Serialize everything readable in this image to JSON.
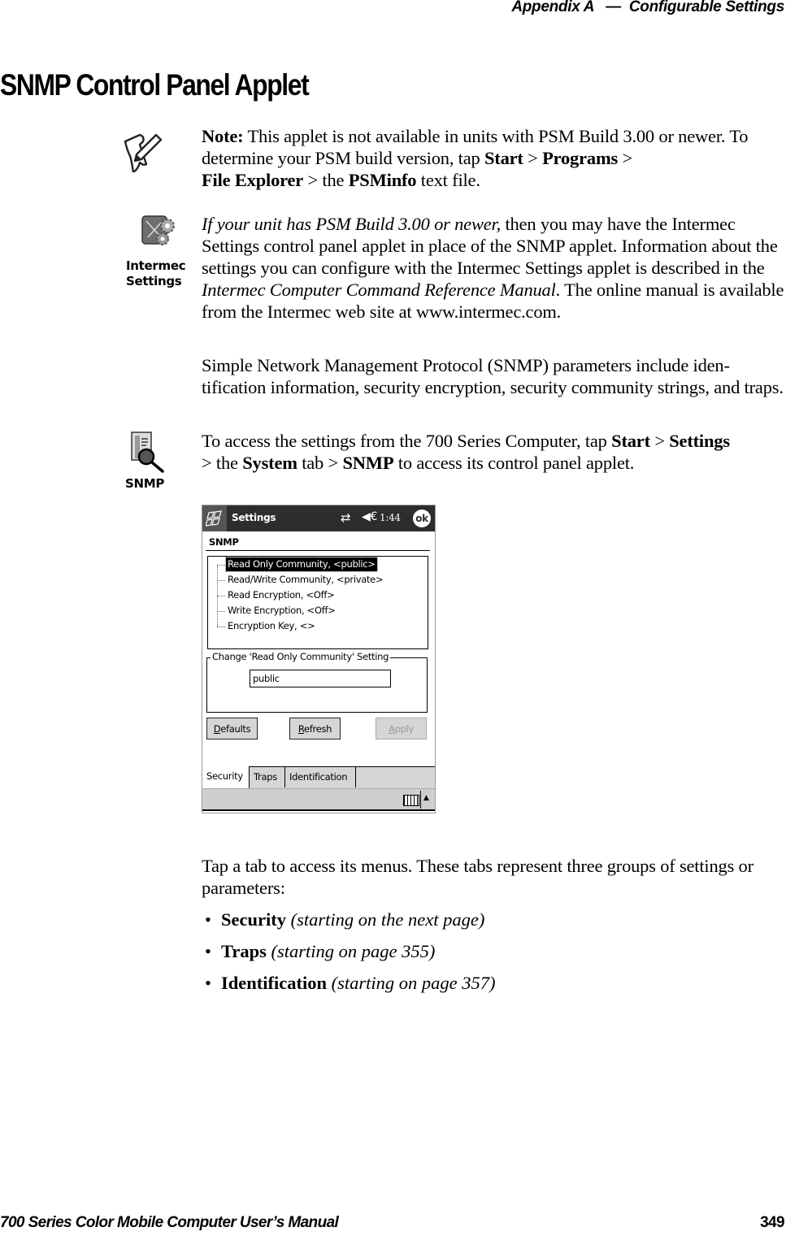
{
  "header": {
    "appendix": "Appendix A",
    "separator": "—",
    "chapter": "Configurable Settings"
  },
  "page_title": "SNMP Control Panel Applet",
  "note": {
    "icon": "note-pencil-icon",
    "label": "Note:",
    "text1": " This applet is not available in units with PSM Build 3.00 or newer. To determine your PSM build version, tap ",
    "start": "Start",
    "sep1": " > ",
    "programs": "Programs",
    "sep2": " > ",
    "file_explorer": "File Explorer",
    "text2": " > the ",
    "psminfo": "PSMinfo",
    "text3": " text file."
  },
  "intermec": {
    "icon": "intermec-settings-icon",
    "caption_line1": "Intermec",
    "caption_line2": "Settings",
    "italic_lead": "If your unit has PSM Build 3.00 or newer,",
    "text1": " then you may have the Intermec Settings control panel applet in place of the SNMP applet. Information about the settings you can configure with the Intermec Settings applet is described in the ",
    "manual": "Intermec Computer Command Reference Manual",
    "text2": ". The online manual is available from the Intermec web site at www.intermec.com."
  },
  "snmp_intro": "Simple Network Management Protocol (SNMP) parameters include iden-tification information, security encryption, security community strings, and traps.",
  "access": {
    "icon": "snmp-icon",
    "caption": "SNMP",
    "text1": "To access the settings from the 700 Series Computer, tap ",
    "start": "Start",
    "sep1": " > ",
    "settings": "Settings",
    "text2": " > the ",
    "system": "System",
    "text3": " tab > ",
    "snmp": "SNMP",
    "text4": " to access its control panel applet."
  },
  "device": {
    "titlebar": {
      "title": "Settings",
      "time": "1:44",
      "ok": "ok",
      "connectivity_icon": "⇄",
      "volume_icon": "◀€"
    },
    "section_title": "SNMP",
    "tree_items": [
      {
        "label": "Read Only Community, <public>",
        "selected": true
      },
      {
        "label": "Read/Write Community, <private>",
        "selected": false
      },
      {
        "label": "Read Encryption, <Off>",
        "selected": false
      },
      {
        "label": "Write Encryption, <Off>",
        "selected": false
      },
      {
        "label": "Encryption Key, <>",
        "selected": false
      }
    ],
    "group_label": "Change 'Read Only Community' Setting",
    "input_value": "public",
    "buttons": {
      "defaults_u": "D",
      "defaults_rest": "efaults",
      "refresh_u": "R",
      "refresh_rest": "efresh",
      "apply_u": "A",
      "apply_rest": "pply"
    },
    "tabs": [
      "Security",
      "Traps",
      "Identification"
    ],
    "active_tab": "Security"
  },
  "tabs_intro": "Tap a tab to access its menus. These tabs represent three groups of settings or parameters:",
  "bullets": [
    {
      "bold": "Security",
      "italic": " (starting on the next page)"
    },
    {
      "bold": "Traps",
      "italic": " (starting on page 355)"
    },
    {
      "bold": "Identification",
      "italic": " (starting on page 357)"
    }
  ],
  "bullet_char": "•",
  "footer": {
    "manual_title": "700 Series Color Mobile Computer User’s Manual",
    "page_number": "349"
  }
}
